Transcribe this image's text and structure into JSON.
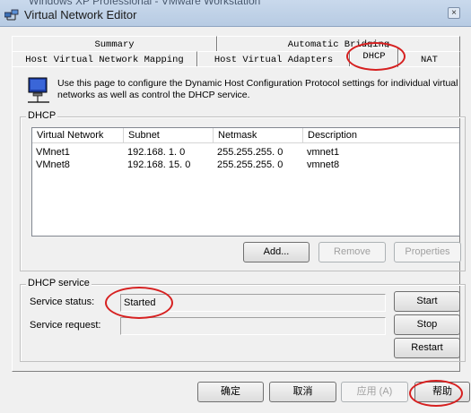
{
  "window": {
    "title_behind": "Windows XP Professional - VMware Workstation",
    "title": "Virtual Network Editor",
    "close_glyph": "×"
  },
  "tabs": {
    "row1": [
      "Summary",
      "Automatic Bridging"
    ],
    "row2": [
      "Host Virtual Network Mapping",
      "Host Virtual Adapters",
      "DHCP",
      "NAT"
    ],
    "active": "DHCP"
  },
  "intro_text": "Use this page to configure the Dynamic Host Configuration Protocol settings for individual virtual networks as well as control the DHCP service.",
  "dhcp_group": {
    "label": "DHCP",
    "columns": [
      "Virtual Network",
      "Subnet",
      "Netmask",
      "Description"
    ],
    "rows": [
      [
        "VMnet1",
        "192.168. 1. 0",
        "255.255.255. 0",
        "vmnet1"
      ],
      [
        "VMnet8",
        "192.168. 15. 0",
        "255.255.255. 0",
        "vmnet8"
      ]
    ],
    "buttons": {
      "add": "Add...",
      "remove": "Remove",
      "properties": "Properties"
    }
  },
  "service_group": {
    "label": "DHCP service",
    "status_label": "Service status:",
    "status_value": "Started",
    "request_label": "Service request:",
    "request_value": "",
    "buttons": {
      "start": "Start",
      "stop": "Stop",
      "restart": "Restart"
    }
  },
  "footer": {
    "ok": "确定",
    "cancel": "取消",
    "apply": "应用 (A)",
    "help": "帮助"
  },
  "icons": {
    "app": "network-editor-icon",
    "intro": "computer-network-icon"
  },
  "colors": {
    "annotation": "#d62020"
  }
}
